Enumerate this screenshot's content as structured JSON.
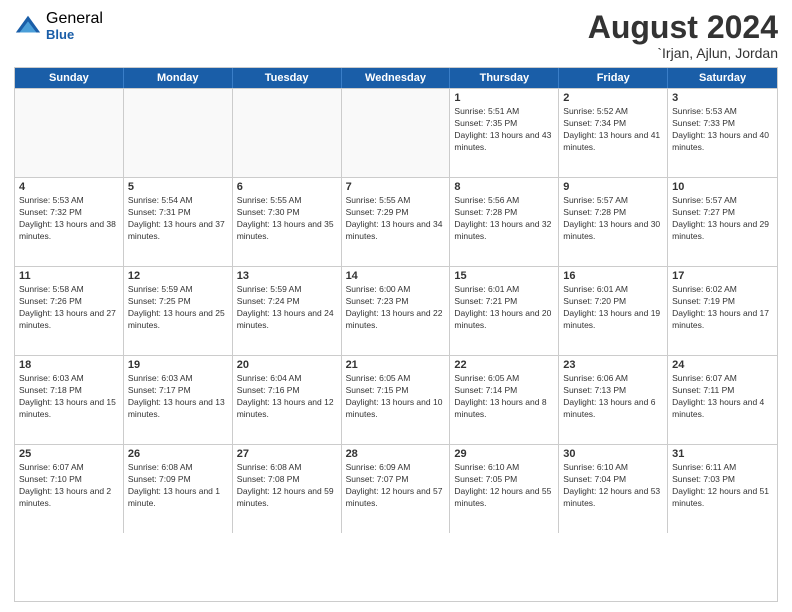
{
  "logo": {
    "general": "General",
    "blue": "Blue"
  },
  "header": {
    "month": "August 2024",
    "location": "`Irjan, Ajlun, Jordan"
  },
  "days_of_week": [
    "Sunday",
    "Monday",
    "Tuesday",
    "Wednesday",
    "Thursday",
    "Friday",
    "Saturday"
  ],
  "weeks": [
    [
      {
        "day": "",
        "empty": true
      },
      {
        "day": "",
        "empty": true
      },
      {
        "day": "",
        "empty": true
      },
      {
        "day": "",
        "empty": true
      },
      {
        "day": "1",
        "sunrise": "5:51 AM",
        "sunset": "7:35 PM",
        "daylight": "13 hours and 43 minutes."
      },
      {
        "day": "2",
        "sunrise": "5:52 AM",
        "sunset": "7:34 PM",
        "daylight": "13 hours and 41 minutes."
      },
      {
        "day": "3",
        "sunrise": "5:53 AM",
        "sunset": "7:33 PM",
        "daylight": "13 hours and 40 minutes."
      }
    ],
    [
      {
        "day": "4",
        "sunrise": "5:53 AM",
        "sunset": "7:32 PM",
        "daylight": "13 hours and 38 minutes."
      },
      {
        "day": "5",
        "sunrise": "5:54 AM",
        "sunset": "7:31 PM",
        "daylight": "13 hours and 37 minutes."
      },
      {
        "day": "6",
        "sunrise": "5:55 AM",
        "sunset": "7:30 PM",
        "daylight": "13 hours and 35 minutes."
      },
      {
        "day": "7",
        "sunrise": "5:55 AM",
        "sunset": "7:29 PM",
        "daylight": "13 hours and 34 minutes."
      },
      {
        "day": "8",
        "sunrise": "5:56 AM",
        "sunset": "7:28 PM",
        "daylight": "13 hours and 32 minutes."
      },
      {
        "day": "9",
        "sunrise": "5:57 AM",
        "sunset": "7:28 PM",
        "daylight": "13 hours and 30 minutes."
      },
      {
        "day": "10",
        "sunrise": "5:57 AM",
        "sunset": "7:27 PM",
        "daylight": "13 hours and 29 minutes."
      }
    ],
    [
      {
        "day": "11",
        "sunrise": "5:58 AM",
        "sunset": "7:26 PM",
        "daylight": "13 hours and 27 minutes."
      },
      {
        "day": "12",
        "sunrise": "5:59 AM",
        "sunset": "7:25 PM",
        "daylight": "13 hours and 25 minutes."
      },
      {
        "day": "13",
        "sunrise": "5:59 AM",
        "sunset": "7:24 PM",
        "daylight": "13 hours and 24 minutes."
      },
      {
        "day": "14",
        "sunrise": "6:00 AM",
        "sunset": "7:23 PM",
        "daylight": "13 hours and 22 minutes."
      },
      {
        "day": "15",
        "sunrise": "6:01 AM",
        "sunset": "7:21 PM",
        "daylight": "13 hours and 20 minutes."
      },
      {
        "day": "16",
        "sunrise": "6:01 AM",
        "sunset": "7:20 PM",
        "daylight": "13 hours and 19 minutes."
      },
      {
        "day": "17",
        "sunrise": "6:02 AM",
        "sunset": "7:19 PM",
        "daylight": "13 hours and 17 minutes."
      }
    ],
    [
      {
        "day": "18",
        "sunrise": "6:03 AM",
        "sunset": "7:18 PM",
        "daylight": "13 hours and 15 minutes."
      },
      {
        "day": "19",
        "sunrise": "6:03 AM",
        "sunset": "7:17 PM",
        "daylight": "13 hours and 13 minutes."
      },
      {
        "day": "20",
        "sunrise": "6:04 AM",
        "sunset": "7:16 PM",
        "daylight": "13 hours and 12 minutes."
      },
      {
        "day": "21",
        "sunrise": "6:05 AM",
        "sunset": "7:15 PM",
        "daylight": "13 hours and 10 minutes."
      },
      {
        "day": "22",
        "sunrise": "6:05 AM",
        "sunset": "7:14 PM",
        "daylight": "13 hours and 8 minutes."
      },
      {
        "day": "23",
        "sunrise": "6:06 AM",
        "sunset": "7:13 PM",
        "daylight": "13 hours and 6 minutes."
      },
      {
        "day": "24",
        "sunrise": "6:07 AM",
        "sunset": "7:11 PM",
        "daylight": "13 hours and 4 minutes."
      }
    ],
    [
      {
        "day": "25",
        "sunrise": "6:07 AM",
        "sunset": "7:10 PM",
        "daylight": "13 hours and 2 minutes."
      },
      {
        "day": "26",
        "sunrise": "6:08 AM",
        "sunset": "7:09 PM",
        "daylight": "13 hours and 1 minute."
      },
      {
        "day": "27",
        "sunrise": "6:08 AM",
        "sunset": "7:08 PM",
        "daylight": "12 hours and 59 minutes."
      },
      {
        "day": "28",
        "sunrise": "6:09 AM",
        "sunset": "7:07 PM",
        "daylight": "12 hours and 57 minutes."
      },
      {
        "day": "29",
        "sunrise": "6:10 AM",
        "sunset": "7:05 PM",
        "daylight": "12 hours and 55 minutes."
      },
      {
        "day": "30",
        "sunrise": "6:10 AM",
        "sunset": "7:04 PM",
        "daylight": "12 hours and 53 minutes."
      },
      {
        "day": "31",
        "sunrise": "6:11 AM",
        "sunset": "7:03 PM",
        "daylight": "12 hours and 51 minutes."
      }
    ]
  ]
}
